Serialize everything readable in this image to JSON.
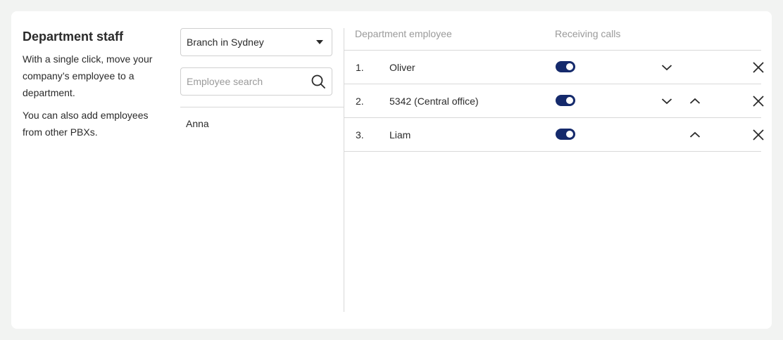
{
  "intro": {
    "title": "Department staff",
    "text1": "With a single click, move your company’s employee to a department.",
    "text2": "You can also add employees from other PBXs."
  },
  "branch_select": {
    "value": "Branch in Sydney"
  },
  "search": {
    "placeholder": "Employee search",
    "icon": "search-icon"
  },
  "available_employees": [
    {
      "name": "Anna"
    }
  ],
  "table": {
    "headers": {
      "employee": "Department employee",
      "receiving": "Receiving calls"
    },
    "rows": [
      {
        "num": "1.",
        "name": "Oliver",
        "receiving_calls": true,
        "can_move_down": true,
        "can_move_up": false
      },
      {
        "num": "2.",
        "name": "5342 (Central office)",
        "receiving_calls": true,
        "can_move_down": true,
        "can_move_up": true
      },
      {
        "num": "3.",
        "name": "Liam",
        "receiving_calls": true,
        "can_move_down": false,
        "can_move_up": true
      }
    ]
  },
  "colors": {
    "toggle_on": "#152a6c",
    "background": "#f2f3f2",
    "card": "#ffffff"
  }
}
